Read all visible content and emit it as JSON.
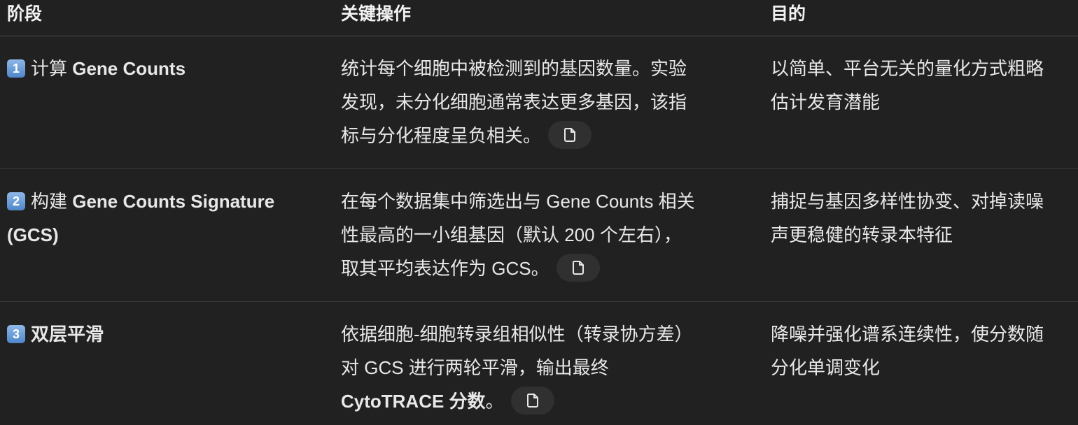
{
  "headers": {
    "stage": "阶段",
    "action": "关键操作",
    "purpose": "目的"
  },
  "rows": [
    {
      "badge": "1",
      "stage_prefix": "计算 ",
      "stage_bold": "Gene Counts",
      "stage_suffix": "",
      "action_line1": "统计每个细胞中被检测到的基因数量。实验",
      "action_line2": "发现，未分化细胞通常表达更多基因，该指",
      "action_line3": "标与分化程度呈负相关。",
      "purpose_line1": "以简单、平台无关的量化方式粗略",
      "purpose_line2": "估计发育潜能",
      "citation_icon": "document-icon"
    },
    {
      "badge": "2",
      "stage_prefix": "构建 ",
      "stage_bold": "Gene Counts Signature",
      "stage_suffix": "(GCS)",
      "action_line1": "在每个数据集中筛选出与 Gene Counts 相关",
      "action_line2": "性最高的一小组基因（默认 200 个左右），",
      "action_line3": "取其平均表达作为 GCS。",
      "purpose_line1": "捕捉与基因多样性协变、对掉读噪",
      "purpose_line2": "声更稳健的转录本特征",
      "citation_icon": "document-icon"
    },
    {
      "badge": "3",
      "stage_prefix": "",
      "stage_bold": "双层平滑",
      "stage_suffix": "",
      "action_line1": "依据细胞-细胞转录组相似性（转录协方差）",
      "action_line2": "对 GCS 进行两轮平滑，输出最终",
      "action_line3_bold": "CytoTRACE 分数",
      "action_line3_tail": "。",
      "purpose_line1": "降噪并强化谱系连续性，使分数随",
      "purpose_line2": "分化单调变化",
      "citation_icon": "document-icon"
    }
  ],
  "colors": {
    "background": "#212121",
    "text": "#e8e8e8",
    "divider": "#3a3a3a",
    "badge": "#5b8fd0"
  }
}
